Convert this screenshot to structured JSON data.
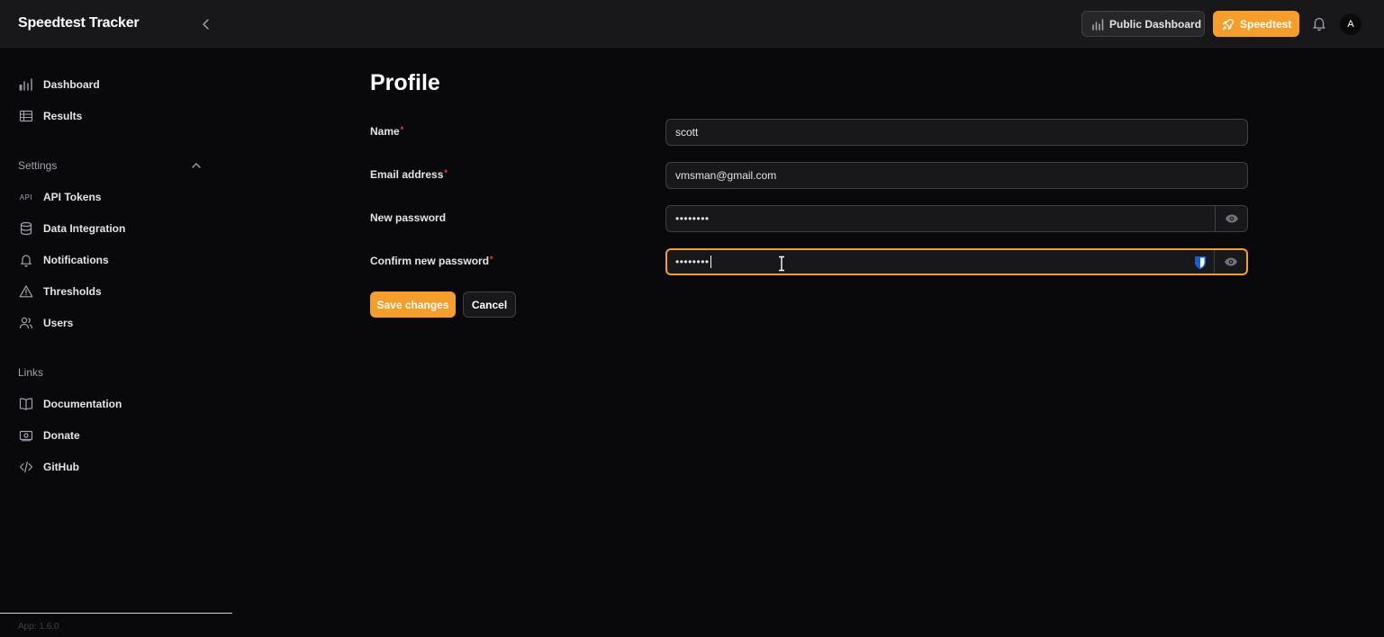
{
  "app": {
    "title": "Speedtest Tracker",
    "version": "App: 1.6.0"
  },
  "header": {
    "public_dashboard_label": "Public Dashboard",
    "speedtest_label": "Speedtest",
    "avatar_initial": "A"
  },
  "sidebar": {
    "main_items": [
      {
        "label": "Dashboard",
        "icon": "bar-chart-icon"
      },
      {
        "label": "Results",
        "icon": "table-icon"
      }
    ],
    "settings": {
      "label": "Settings",
      "items": [
        {
          "label": "API Tokens",
          "icon": "api-icon",
          "icon_text": "API"
        },
        {
          "label": "Data Integration",
          "icon": "database-icon"
        },
        {
          "label": "Notifications",
          "icon": "bell-icon"
        },
        {
          "label": "Thresholds",
          "icon": "warning-icon"
        },
        {
          "label": "Users",
          "icon": "users-icon"
        }
      ]
    },
    "links": {
      "label": "Links",
      "items": [
        {
          "label": "Documentation",
          "icon": "book-icon"
        },
        {
          "label": "Donate",
          "icon": "money-icon"
        },
        {
          "label": "GitHub",
          "icon": "code-icon"
        }
      ]
    }
  },
  "form": {
    "title": "Profile",
    "required_mark": "*",
    "name": {
      "label": "Name",
      "value": "scott"
    },
    "email": {
      "label": "Email address",
      "value": "vmsman@gmail.com"
    },
    "new_password": {
      "label": "New password",
      "value": "••••••••"
    },
    "confirm_password": {
      "label": "Confirm new password",
      "value": "••••••••"
    },
    "save_label": "Save changes",
    "cancel_label": "Cancel"
  },
  "colors": {
    "accent": "#f59e2a",
    "background": "#09090b",
    "surface": "#18181b",
    "required": "#ef4444",
    "bitwarden": "#175ddc"
  }
}
